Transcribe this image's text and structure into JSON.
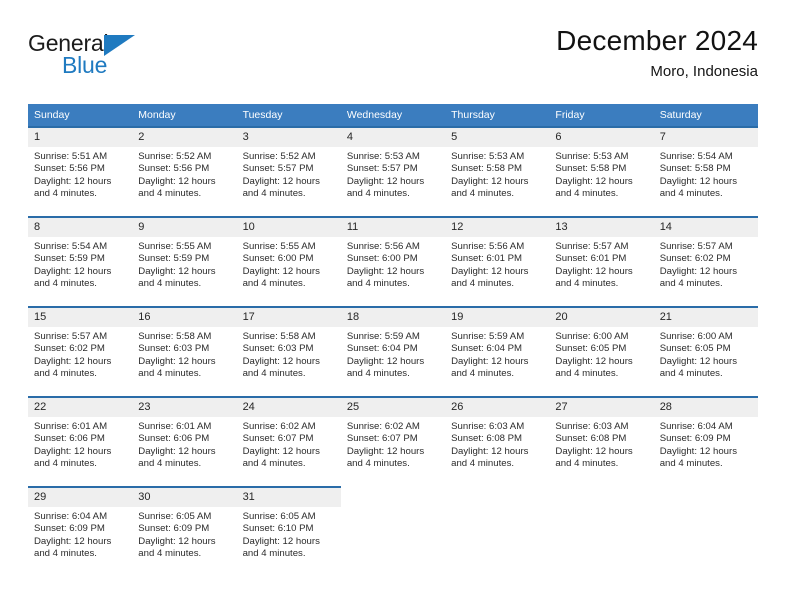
{
  "brand": {
    "name_top": "General",
    "name_bottom": "Blue",
    "accent_color": "#1f7ac0"
  },
  "header": {
    "title": "December 2024",
    "subtitle": "Moro, Indonesia"
  },
  "theme": {
    "header_bg": "#3b7dbf",
    "row_divider": "#2a6ca8",
    "daynum_band": "#efefef",
    "page_bg": "#ffffff"
  },
  "labels": {
    "sunrise_prefix": "Sunrise:",
    "sunset_prefix": "Sunset:",
    "daylight_prefix": "Daylight:"
  },
  "weekdays": [
    "Sunday",
    "Monday",
    "Tuesday",
    "Wednesday",
    "Thursday",
    "Friday",
    "Saturday"
  ],
  "weeks": [
    [
      {
        "day": "1",
        "sunrise": "Sunrise: 5:51 AM",
        "sunset": "Sunset: 5:56 PM",
        "daylight1": "Daylight: 12 hours",
        "daylight2": "and 4 minutes."
      },
      {
        "day": "2",
        "sunrise": "Sunrise: 5:52 AM",
        "sunset": "Sunset: 5:56 PM",
        "daylight1": "Daylight: 12 hours",
        "daylight2": "and 4 minutes."
      },
      {
        "day": "3",
        "sunrise": "Sunrise: 5:52 AM",
        "sunset": "Sunset: 5:57 PM",
        "daylight1": "Daylight: 12 hours",
        "daylight2": "and 4 minutes."
      },
      {
        "day": "4",
        "sunrise": "Sunrise: 5:53 AM",
        "sunset": "Sunset: 5:57 PM",
        "daylight1": "Daylight: 12 hours",
        "daylight2": "and 4 minutes."
      },
      {
        "day": "5",
        "sunrise": "Sunrise: 5:53 AM",
        "sunset": "Sunset: 5:58 PM",
        "daylight1": "Daylight: 12 hours",
        "daylight2": "and 4 minutes."
      },
      {
        "day": "6",
        "sunrise": "Sunrise: 5:53 AM",
        "sunset": "Sunset: 5:58 PM",
        "daylight1": "Daylight: 12 hours",
        "daylight2": "and 4 minutes."
      },
      {
        "day": "7",
        "sunrise": "Sunrise: 5:54 AM",
        "sunset": "Sunset: 5:58 PM",
        "daylight1": "Daylight: 12 hours",
        "daylight2": "and 4 minutes."
      }
    ],
    [
      {
        "day": "8",
        "sunrise": "Sunrise: 5:54 AM",
        "sunset": "Sunset: 5:59 PM",
        "daylight1": "Daylight: 12 hours",
        "daylight2": "and 4 minutes."
      },
      {
        "day": "9",
        "sunrise": "Sunrise: 5:55 AM",
        "sunset": "Sunset: 5:59 PM",
        "daylight1": "Daylight: 12 hours",
        "daylight2": "and 4 minutes."
      },
      {
        "day": "10",
        "sunrise": "Sunrise: 5:55 AM",
        "sunset": "Sunset: 6:00 PM",
        "daylight1": "Daylight: 12 hours",
        "daylight2": "and 4 minutes."
      },
      {
        "day": "11",
        "sunrise": "Sunrise: 5:56 AM",
        "sunset": "Sunset: 6:00 PM",
        "daylight1": "Daylight: 12 hours",
        "daylight2": "and 4 minutes."
      },
      {
        "day": "12",
        "sunrise": "Sunrise: 5:56 AM",
        "sunset": "Sunset: 6:01 PM",
        "daylight1": "Daylight: 12 hours",
        "daylight2": "and 4 minutes."
      },
      {
        "day": "13",
        "sunrise": "Sunrise: 5:57 AM",
        "sunset": "Sunset: 6:01 PM",
        "daylight1": "Daylight: 12 hours",
        "daylight2": "and 4 minutes."
      },
      {
        "day": "14",
        "sunrise": "Sunrise: 5:57 AM",
        "sunset": "Sunset: 6:02 PM",
        "daylight1": "Daylight: 12 hours",
        "daylight2": "and 4 minutes."
      }
    ],
    [
      {
        "day": "15",
        "sunrise": "Sunrise: 5:57 AM",
        "sunset": "Sunset: 6:02 PM",
        "daylight1": "Daylight: 12 hours",
        "daylight2": "and 4 minutes."
      },
      {
        "day": "16",
        "sunrise": "Sunrise: 5:58 AM",
        "sunset": "Sunset: 6:03 PM",
        "daylight1": "Daylight: 12 hours",
        "daylight2": "and 4 minutes."
      },
      {
        "day": "17",
        "sunrise": "Sunrise: 5:58 AM",
        "sunset": "Sunset: 6:03 PM",
        "daylight1": "Daylight: 12 hours",
        "daylight2": "and 4 minutes."
      },
      {
        "day": "18",
        "sunrise": "Sunrise: 5:59 AM",
        "sunset": "Sunset: 6:04 PM",
        "daylight1": "Daylight: 12 hours",
        "daylight2": "and 4 minutes."
      },
      {
        "day": "19",
        "sunrise": "Sunrise: 5:59 AM",
        "sunset": "Sunset: 6:04 PM",
        "daylight1": "Daylight: 12 hours",
        "daylight2": "and 4 minutes."
      },
      {
        "day": "20",
        "sunrise": "Sunrise: 6:00 AM",
        "sunset": "Sunset: 6:05 PM",
        "daylight1": "Daylight: 12 hours",
        "daylight2": "and 4 minutes."
      },
      {
        "day": "21",
        "sunrise": "Sunrise: 6:00 AM",
        "sunset": "Sunset: 6:05 PM",
        "daylight1": "Daylight: 12 hours",
        "daylight2": "and 4 minutes."
      }
    ],
    [
      {
        "day": "22",
        "sunrise": "Sunrise: 6:01 AM",
        "sunset": "Sunset: 6:06 PM",
        "daylight1": "Daylight: 12 hours",
        "daylight2": "and 4 minutes."
      },
      {
        "day": "23",
        "sunrise": "Sunrise: 6:01 AM",
        "sunset": "Sunset: 6:06 PM",
        "daylight1": "Daylight: 12 hours",
        "daylight2": "and 4 minutes."
      },
      {
        "day": "24",
        "sunrise": "Sunrise: 6:02 AM",
        "sunset": "Sunset: 6:07 PM",
        "daylight1": "Daylight: 12 hours",
        "daylight2": "and 4 minutes."
      },
      {
        "day": "25",
        "sunrise": "Sunrise: 6:02 AM",
        "sunset": "Sunset: 6:07 PM",
        "daylight1": "Daylight: 12 hours",
        "daylight2": "and 4 minutes."
      },
      {
        "day": "26",
        "sunrise": "Sunrise: 6:03 AM",
        "sunset": "Sunset: 6:08 PM",
        "daylight1": "Daylight: 12 hours",
        "daylight2": "and 4 minutes."
      },
      {
        "day": "27",
        "sunrise": "Sunrise: 6:03 AM",
        "sunset": "Sunset: 6:08 PM",
        "daylight1": "Daylight: 12 hours",
        "daylight2": "and 4 minutes."
      },
      {
        "day": "28",
        "sunrise": "Sunrise: 6:04 AM",
        "sunset": "Sunset: 6:09 PM",
        "daylight1": "Daylight: 12 hours",
        "daylight2": "and 4 minutes."
      }
    ],
    [
      {
        "day": "29",
        "sunrise": "Sunrise: 6:04 AM",
        "sunset": "Sunset: 6:09 PM",
        "daylight1": "Daylight: 12 hours",
        "daylight2": "and 4 minutes."
      },
      {
        "day": "30",
        "sunrise": "Sunrise: 6:05 AM",
        "sunset": "Sunset: 6:09 PM",
        "daylight1": "Daylight: 12 hours",
        "daylight2": "and 4 minutes."
      },
      {
        "day": "31",
        "sunrise": "Sunrise: 6:05 AM",
        "sunset": "Sunset: 6:10 PM",
        "daylight1": "Daylight: 12 hours",
        "daylight2": "and 4 minutes."
      },
      {
        "day": "",
        "sunrise": "",
        "sunset": "",
        "daylight1": "",
        "daylight2": ""
      },
      {
        "day": "",
        "sunrise": "",
        "sunset": "",
        "daylight1": "",
        "daylight2": ""
      },
      {
        "day": "",
        "sunrise": "",
        "sunset": "",
        "daylight1": "",
        "daylight2": ""
      },
      {
        "day": "",
        "sunrise": "",
        "sunset": "",
        "daylight1": "",
        "daylight2": ""
      }
    ]
  ]
}
